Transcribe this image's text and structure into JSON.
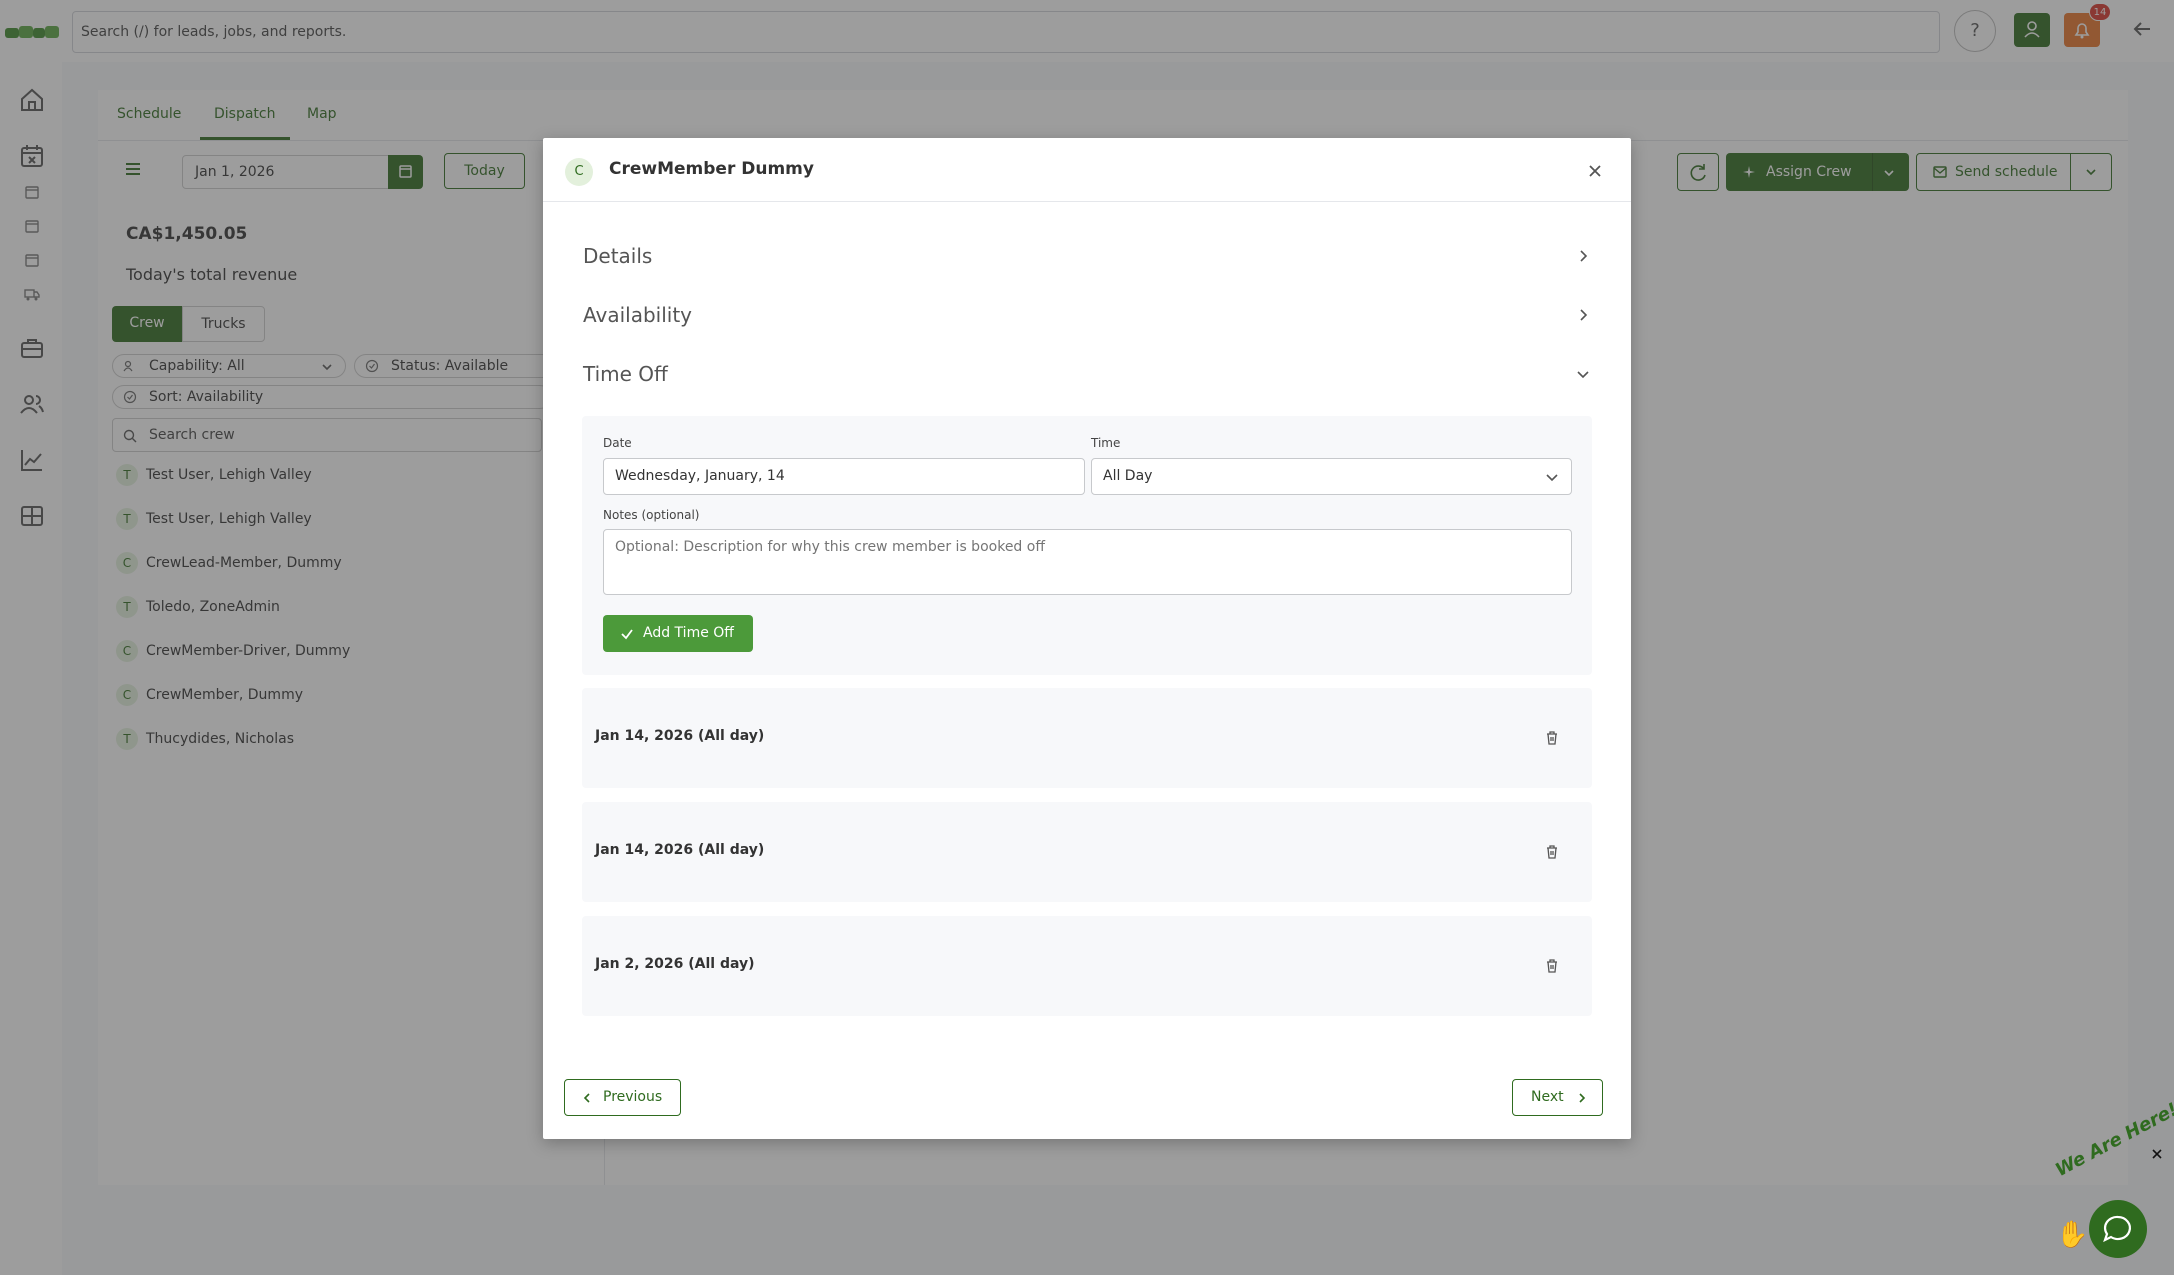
{
  "colors": {
    "brand": "#2f6b1f",
    "brand_light": "#4c9a3a",
    "notification": "#e8742b",
    "badge": "#d9342b",
    "overlay": "rgba(60,60,60,0.5)"
  },
  "topbar": {
    "search_placeholder": "Search (/) for leads, jobs, and reports.",
    "help_label": "?",
    "notification_count": "14"
  },
  "nav_tabs": [
    "Schedule",
    "Dispatch",
    "Map"
  ],
  "toolbar": {
    "date_value": "Jan 1, 2026",
    "today_label": "Today",
    "assign_crew_label": "Assign Crew",
    "send_schedule_label": "Send schedule"
  },
  "revenue": {
    "amount": "CA$1,450.05",
    "label": "Today's total revenue"
  },
  "segment": {
    "crew": "Crew",
    "trucks": "Trucks"
  },
  "filters": {
    "capability": "Capability: All",
    "status": "Status: Available",
    "sort": "Sort: Availability",
    "search_placeholder": "Search crew"
  },
  "crew_list": [
    {
      "initial": "T",
      "name": "Test User, Lehigh Valley"
    },
    {
      "initial": "T",
      "name": "Test User, Lehigh Valley"
    },
    {
      "initial": "C",
      "name": "CrewLead-Member, Dummy"
    },
    {
      "initial": "T",
      "name": "Toledo, ZoneAdmin"
    },
    {
      "initial": "C",
      "name": "CrewMember-Driver, Dummy"
    },
    {
      "initial": "C",
      "name": "CrewMember, Dummy"
    },
    {
      "initial": "T",
      "name": "Thucydides, Nicholas"
    }
  ],
  "modal": {
    "avatar_initial": "C",
    "title": "CrewMember Dummy",
    "sections": {
      "details": "Details",
      "availability": "Availability",
      "time_off": "Time Off"
    },
    "form": {
      "date_label": "Date",
      "date_value": "Wednesday, January, 14",
      "time_label": "Time",
      "time_value": "All Day",
      "notes_label": "Notes (optional)",
      "notes_placeholder": "Optional: Description for why this crew member is booked off",
      "add_button": "Add Time Off"
    },
    "entries": [
      "Jan 14, 2026 (All day)",
      "Jan 14, 2026 (All day)",
      "Jan 2, 2026 (All day)"
    ],
    "previous_label": "Previous",
    "next_label": "Next"
  },
  "chat_widget": {
    "tagline": "We Are Here!"
  }
}
